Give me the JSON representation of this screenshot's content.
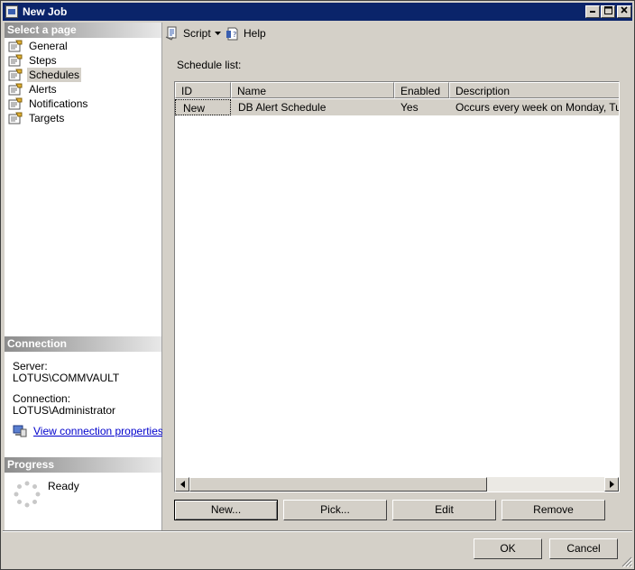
{
  "window": {
    "title": "New Job"
  },
  "left_panel": {
    "select_page_header": "Select a page",
    "pages": [
      {
        "label": "General"
      },
      {
        "label": "Steps"
      },
      {
        "label": "Schedules"
      },
      {
        "label": "Alerts"
      },
      {
        "label": "Notifications"
      },
      {
        "label": "Targets"
      }
    ],
    "selected_page": "Schedules",
    "connection": {
      "header": "Connection",
      "server_label": "Server:",
      "server_value": "LOTUS\\COMMVAULT",
      "connection_label": "Connection:",
      "connection_value": "LOTUS\\Administrator",
      "view_link": "View connection properties"
    },
    "progress": {
      "header": "Progress",
      "status": "Ready"
    }
  },
  "toolbar": {
    "script_label": "Script",
    "help_label": "Help"
  },
  "schedules": {
    "list_label": "Schedule list:",
    "columns": [
      "ID",
      "Name",
      "Enabled",
      "Description"
    ],
    "rows": [
      {
        "id": "New",
        "name": "DB Alert Schedule",
        "enabled": "Yes",
        "description": "Occurs every week on Monday, Tuesday"
      }
    ],
    "buttons": {
      "new": "New...",
      "pick": "Pick...",
      "edit": "Edit",
      "remove": "Remove"
    }
  },
  "footer": {
    "ok": "OK",
    "cancel": "Cancel"
  }
}
